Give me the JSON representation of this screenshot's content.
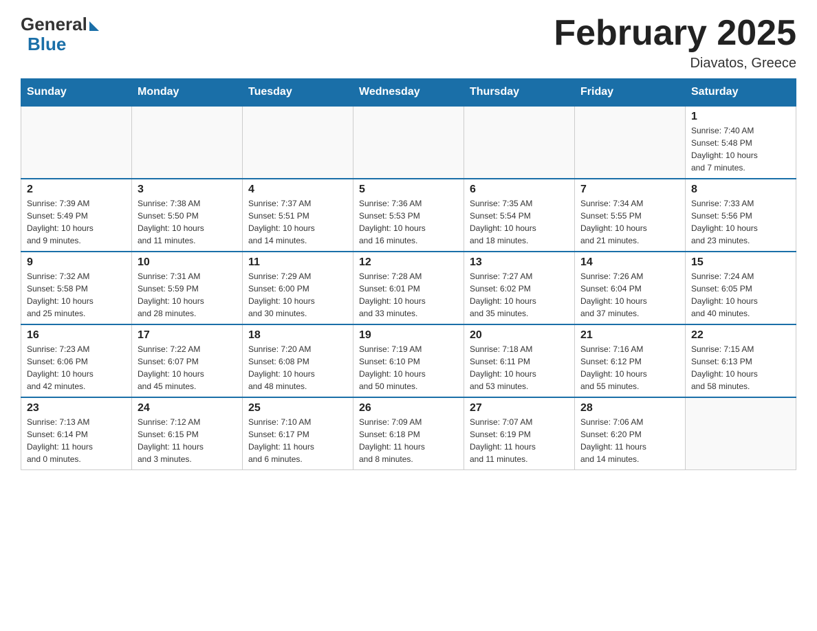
{
  "header": {
    "logo_general": "General",
    "logo_blue": "Blue",
    "month_title": "February 2025",
    "location": "Diavatos, Greece"
  },
  "days_of_week": [
    "Sunday",
    "Monday",
    "Tuesday",
    "Wednesday",
    "Thursday",
    "Friday",
    "Saturday"
  ],
  "weeks": [
    [
      {
        "day": "",
        "info": ""
      },
      {
        "day": "",
        "info": ""
      },
      {
        "day": "",
        "info": ""
      },
      {
        "day": "",
        "info": ""
      },
      {
        "day": "",
        "info": ""
      },
      {
        "day": "",
        "info": ""
      },
      {
        "day": "1",
        "info": "Sunrise: 7:40 AM\nSunset: 5:48 PM\nDaylight: 10 hours\nand 7 minutes."
      }
    ],
    [
      {
        "day": "2",
        "info": "Sunrise: 7:39 AM\nSunset: 5:49 PM\nDaylight: 10 hours\nand 9 minutes."
      },
      {
        "day": "3",
        "info": "Sunrise: 7:38 AM\nSunset: 5:50 PM\nDaylight: 10 hours\nand 11 minutes."
      },
      {
        "day": "4",
        "info": "Sunrise: 7:37 AM\nSunset: 5:51 PM\nDaylight: 10 hours\nand 14 minutes."
      },
      {
        "day": "5",
        "info": "Sunrise: 7:36 AM\nSunset: 5:53 PM\nDaylight: 10 hours\nand 16 minutes."
      },
      {
        "day": "6",
        "info": "Sunrise: 7:35 AM\nSunset: 5:54 PM\nDaylight: 10 hours\nand 18 minutes."
      },
      {
        "day": "7",
        "info": "Sunrise: 7:34 AM\nSunset: 5:55 PM\nDaylight: 10 hours\nand 21 minutes."
      },
      {
        "day": "8",
        "info": "Sunrise: 7:33 AM\nSunset: 5:56 PM\nDaylight: 10 hours\nand 23 minutes."
      }
    ],
    [
      {
        "day": "9",
        "info": "Sunrise: 7:32 AM\nSunset: 5:58 PM\nDaylight: 10 hours\nand 25 minutes."
      },
      {
        "day": "10",
        "info": "Sunrise: 7:31 AM\nSunset: 5:59 PM\nDaylight: 10 hours\nand 28 minutes."
      },
      {
        "day": "11",
        "info": "Sunrise: 7:29 AM\nSunset: 6:00 PM\nDaylight: 10 hours\nand 30 minutes."
      },
      {
        "day": "12",
        "info": "Sunrise: 7:28 AM\nSunset: 6:01 PM\nDaylight: 10 hours\nand 33 minutes."
      },
      {
        "day": "13",
        "info": "Sunrise: 7:27 AM\nSunset: 6:02 PM\nDaylight: 10 hours\nand 35 minutes."
      },
      {
        "day": "14",
        "info": "Sunrise: 7:26 AM\nSunset: 6:04 PM\nDaylight: 10 hours\nand 37 minutes."
      },
      {
        "day": "15",
        "info": "Sunrise: 7:24 AM\nSunset: 6:05 PM\nDaylight: 10 hours\nand 40 minutes."
      }
    ],
    [
      {
        "day": "16",
        "info": "Sunrise: 7:23 AM\nSunset: 6:06 PM\nDaylight: 10 hours\nand 42 minutes."
      },
      {
        "day": "17",
        "info": "Sunrise: 7:22 AM\nSunset: 6:07 PM\nDaylight: 10 hours\nand 45 minutes."
      },
      {
        "day": "18",
        "info": "Sunrise: 7:20 AM\nSunset: 6:08 PM\nDaylight: 10 hours\nand 48 minutes."
      },
      {
        "day": "19",
        "info": "Sunrise: 7:19 AM\nSunset: 6:10 PM\nDaylight: 10 hours\nand 50 minutes."
      },
      {
        "day": "20",
        "info": "Sunrise: 7:18 AM\nSunset: 6:11 PM\nDaylight: 10 hours\nand 53 minutes."
      },
      {
        "day": "21",
        "info": "Sunrise: 7:16 AM\nSunset: 6:12 PM\nDaylight: 10 hours\nand 55 minutes."
      },
      {
        "day": "22",
        "info": "Sunrise: 7:15 AM\nSunset: 6:13 PM\nDaylight: 10 hours\nand 58 minutes."
      }
    ],
    [
      {
        "day": "23",
        "info": "Sunrise: 7:13 AM\nSunset: 6:14 PM\nDaylight: 11 hours\nand 0 minutes."
      },
      {
        "day": "24",
        "info": "Sunrise: 7:12 AM\nSunset: 6:15 PM\nDaylight: 11 hours\nand 3 minutes."
      },
      {
        "day": "25",
        "info": "Sunrise: 7:10 AM\nSunset: 6:17 PM\nDaylight: 11 hours\nand 6 minutes."
      },
      {
        "day": "26",
        "info": "Sunrise: 7:09 AM\nSunset: 6:18 PM\nDaylight: 11 hours\nand 8 minutes."
      },
      {
        "day": "27",
        "info": "Sunrise: 7:07 AM\nSunset: 6:19 PM\nDaylight: 11 hours\nand 11 minutes."
      },
      {
        "day": "28",
        "info": "Sunrise: 7:06 AM\nSunset: 6:20 PM\nDaylight: 11 hours\nand 14 minutes."
      },
      {
        "day": "",
        "info": ""
      }
    ]
  ]
}
